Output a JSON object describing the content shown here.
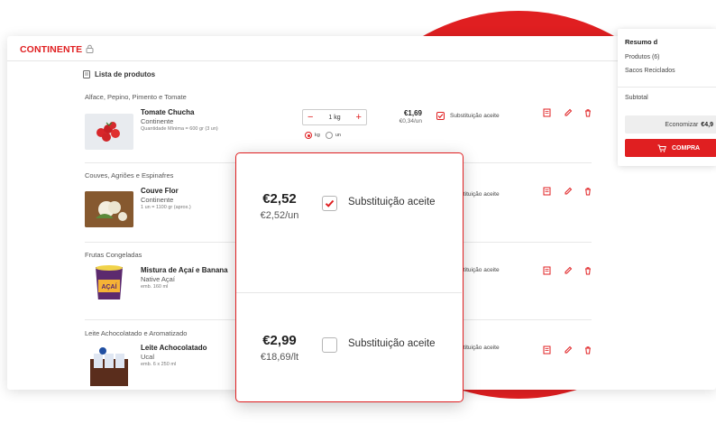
{
  "brand": {
    "logo_text": "CONTINENTE",
    "lock_icon": "lock-icon"
  },
  "list": {
    "title": "Lista de produtos"
  },
  "products": [
    {
      "category": "Alface, Pepino, Pimento e Tomate",
      "name": "Tomate Chucha",
      "brand": "Continente",
      "qty": "Quantidade Mínima = 600 gr (3 un)",
      "price": "€1,69",
      "unit_price": "€0,34/un",
      "substitution": "Substituição aceite",
      "substitution_checked": true,
      "quantity": "1 kg",
      "unit_options": [
        "kg",
        "un"
      ],
      "unit_selected": "kg"
    },
    {
      "category": "Couves, Agriões e Espinafres",
      "name": "Couve Flor",
      "brand": "Continente",
      "qty": "1 un = 1100 gr (aprox.)",
      "substitution": "Substituição aceite"
    },
    {
      "category": "Frutas Congeladas",
      "name": "Mistura de Açaí e Banana",
      "brand": "Native Açaí",
      "qty": "emb. 160 ml",
      "substitution": "Substituição aceite"
    },
    {
      "category": "Leite Achocolatado e Aromatizado",
      "name": "Leite Achocolatado",
      "brand": "Ucal",
      "qty": "emb. 6 x 250 ml",
      "substitution": "Substituição aceite"
    }
  ],
  "summary": {
    "title": "Resumo d",
    "products": "Produtos (6)",
    "bags": "Sacos Reciclados",
    "subtotal": "Subtotal",
    "save_label": "Economizar",
    "save_amount": "€4,9",
    "buy_label": "COMPRA"
  },
  "popup": {
    "rows": [
      {
        "price": "€2,52",
        "unit_price": "€2,52/un",
        "label": "Substituição aceite",
        "checked": true
      },
      {
        "price": "€2,99",
        "unit_price": "€18,69/lt",
        "label": "Substituição aceite",
        "checked": false
      }
    ]
  },
  "colors": {
    "accent": "#e01f21",
    "circle": "#e01f21"
  },
  "icons": [
    "lock-icon",
    "list-icon",
    "minus-icon",
    "plus-icon",
    "check-icon",
    "notes-icon",
    "edit-icon",
    "trash-icon",
    "cart-icon"
  ]
}
